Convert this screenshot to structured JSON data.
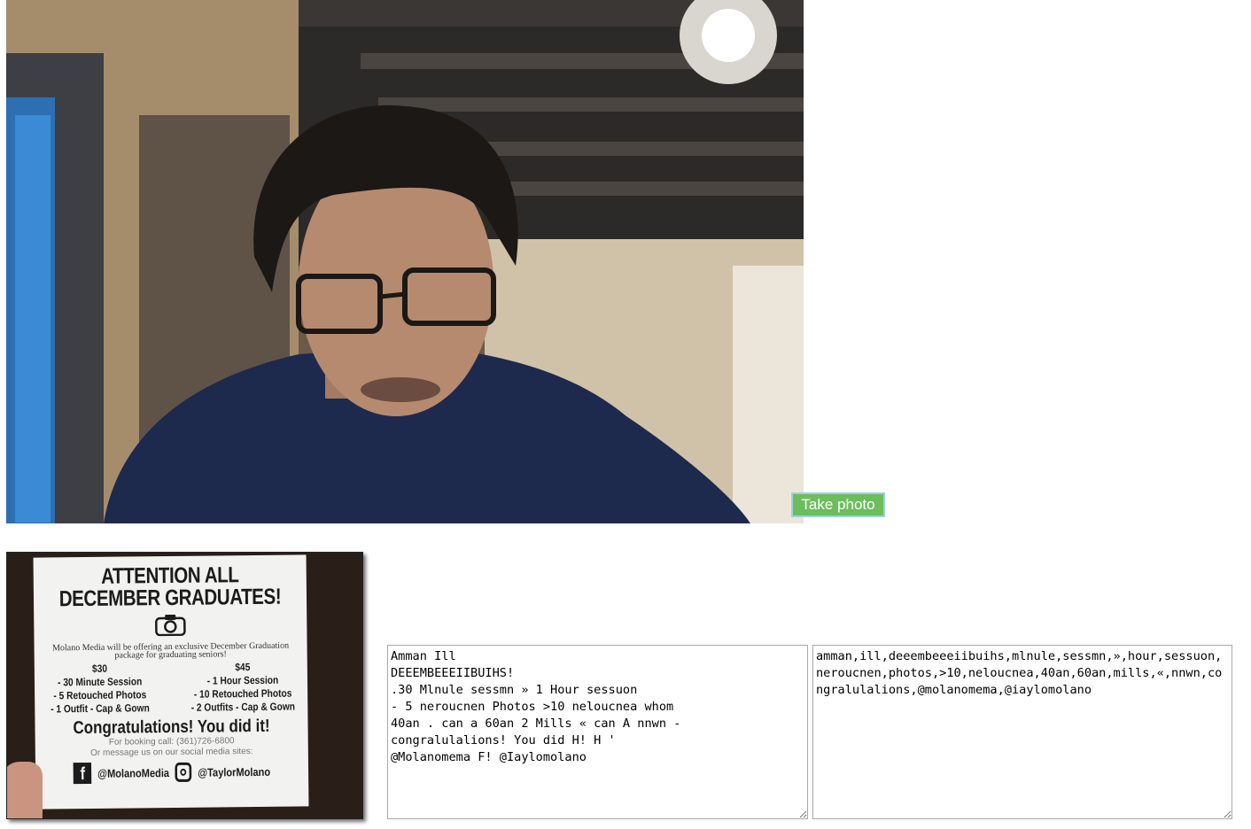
{
  "camera": {
    "take_photo_label": "Take photo",
    "colors": {
      "button_bg": "#6cbd5c",
      "button_border": "#9fcfe6"
    }
  },
  "flyer": {
    "title_line1": "ATTENTION ALL",
    "title_line2": "DECEMBER GRADUATES!",
    "description": "Molano Media will be offering an exclusive December Graduation package for graduating seniors!",
    "left_column": {
      "price": "$30",
      "items": [
        "- 30 Minute Session",
        "- 5 Retouched Photos",
        "- 1 Outfit - Cap & Gown"
      ]
    },
    "right_column": {
      "price": "$45",
      "items": [
        "- 1 Hour Session",
        "- 10 Retouched Photos",
        "- 2 Outfits - Cap & Gown"
      ]
    },
    "congrats": "Congratulations! You did it!",
    "booking": "For booking call: (361)726-6800",
    "message": "Or message us on our social media sites:",
    "facebook_handle": "@MolanoMedia",
    "instagram_handle": "@TaylorMolano"
  },
  "ocr_text": "Amman Ill\nDEEEMBEEEIIBUIHS!\n.30 Mlnule sessmn » 1 Hour sessuon\n- 5 neroucnen Photos >10 neloucnea whom\n40an . can a 60an 2 Mills « can A nnwn -\ncongralulalions! You did H! H '\n@Molanomema F! @Iaylomolano",
  "tokens_text": "amman,ill,deeembeeeiibuihs,mlnule,sessmn,»,hour,sessuon,neroucnen,photos,>10,neloucnea,40an,60an,mills,«,nnwn,congralulalions,@molanomema,@iaylomolano"
}
